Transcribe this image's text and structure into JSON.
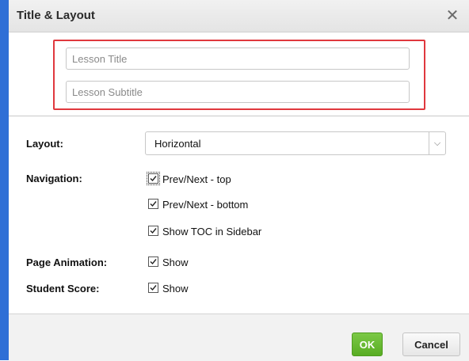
{
  "dialog": {
    "title": "Title & Layout",
    "close_symbol": "✕"
  },
  "title_fields": {
    "lesson_title": {
      "value": "",
      "placeholder": "Lesson Title"
    },
    "lesson_subtitle": {
      "value": "",
      "placeholder": "Lesson Subtitle"
    }
  },
  "layout": {
    "label": "Layout:",
    "selected": "Horizontal",
    "arrow_icon": "chevron-down-icon"
  },
  "navigation": {
    "label": "Navigation:",
    "options": [
      {
        "label": "Prev/Next - top",
        "checked": true,
        "focused": true
      },
      {
        "label": "Prev/Next - bottom",
        "checked": true
      },
      {
        "label": "Show TOC in Sidebar",
        "checked": true
      }
    ]
  },
  "page_animation": {
    "label": "Page Animation:",
    "option_label": "Show",
    "checked": true
  },
  "student_score": {
    "label": "Student Score:",
    "option_label": "Show",
    "checked": true
  },
  "footer": {
    "ok_label": "OK",
    "cancel_label": "Cancel"
  },
  "colors": {
    "ok_green": "#58ad23",
    "highlight_red": "#e0383e",
    "page_edge_blue": "#2f6fd6"
  }
}
